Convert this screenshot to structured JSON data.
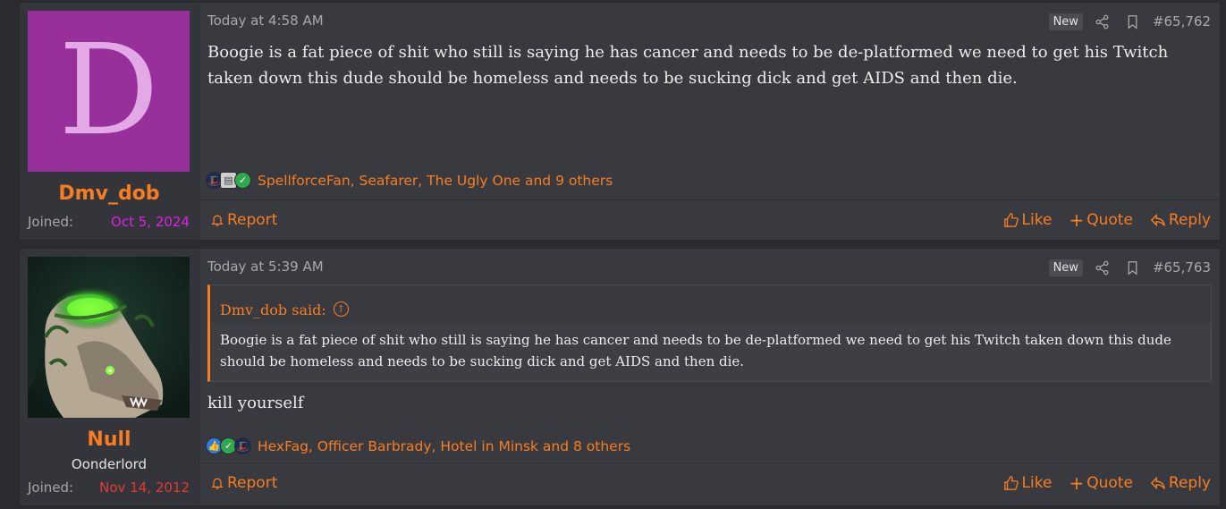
{
  "posts": [
    {
      "avatar_letter": "D",
      "username": "Dmv_dob",
      "joined_label": "Joined:",
      "joined_date": "Oct 5, 2024",
      "joined_date_color": "#e020e6",
      "date": "Today at 4:58 AM",
      "badge": "New",
      "post_number": "#65,762",
      "body": "Boogie is a fat piece of shit who still is saying he has cancer and needs to be de-platformed we need to get his Twitch taken down this dude should be homeless and needs to be sucking dick and get AIDS and then die.",
      "reactions_icons": [
        "top-hat-icon",
        "paper-icon",
        "check-icon"
      ],
      "reactions_text": "SpellforceFan, Seafarer, The Ugly One and 9 others",
      "report": "Report",
      "like": "Like",
      "quote": "Quote",
      "reply": "Reply"
    },
    {
      "username": "Null",
      "user_title": "Oonderlord",
      "joined_label": "Joined:",
      "joined_date": "Nov 14, 2012",
      "joined_date_color": "#e53935",
      "date": "Today at 5:39 AM",
      "badge": "New",
      "post_number": "#65,763",
      "quote_author": "Dmv_dob said:",
      "quote_text": "Boogie is a fat piece of shit who still is saying he has cancer and needs to be de-platformed we need to get his Twitch taken down this dude should be homeless and needs to be sucking dick and get AIDS and then die.",
      "body": "kill yourself",
      "reactions_icons": [
        "thumbs-up-icon",
        "check-icon",
        "top-hat-icon"
      ],
      "reactions_text": "HexFag, Officer Barbrady, Hotel in Minsk and 8 others",
      "report": "Report",
      "like": "Like",
      "quote": "Quote",
      "reply": "Reply"
    }
  ],
  "colors": {
    "accent": "#f97d20",
    "background": "#2a2c30",
    "post_bg": "#383a3f"
  }
}
